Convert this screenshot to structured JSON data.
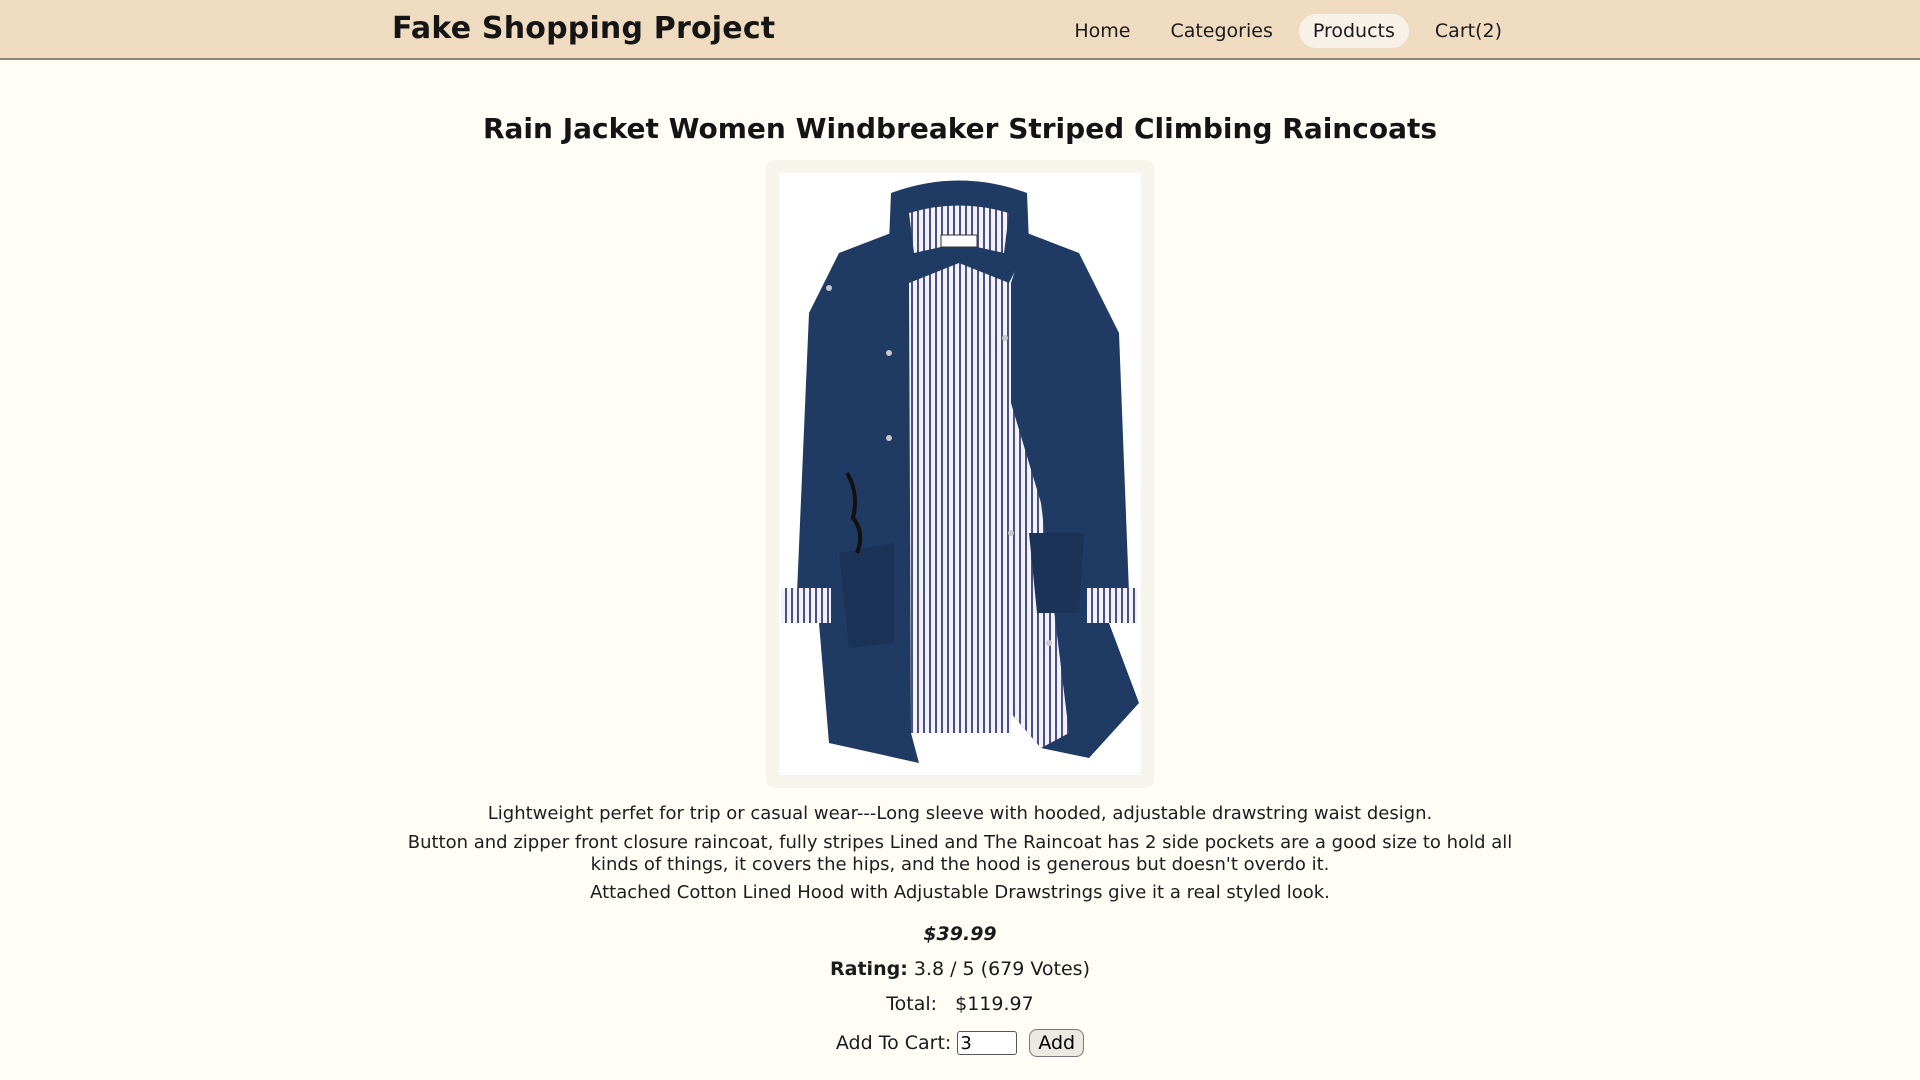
{
  "header": {
    "brand": "Fake Shopping Project",
    "nav": [
      {
        "label": "Home"
      },
      {
        "label": "Categories"
      },
      {
        "label": "Products",
        "active": true
      },
      {
        "label": "Cart(2)"
      }
    ]
  },
  "product": {
    "title": "Rain Jacket Women Windbreaker Striped Climbing Raincoats",
    "image_icon": "navy-rain-jacket-image",
    "description": [
      "Lightweight perfet for trip or casual wear---Long sleeve with hooded, adjustable drawstring waist design.",
      "Button and zipper front closure raincoat, fully stripes Lined and The Raincoat has 2 side pockets are a good size to hold all kinds of things, it covers the hips, and the hood is generous but doesn't overdo it.",
      "Attached Cotton Lined Hood with Adjustable Drawstrings give it a real styled look."
    ],
    "price": "$39.99",
    "rating_label": "Rating:",
    "rating_value": "3.8 / 5 (679 Votes)",
    "total_label": "Total:",
    "total_value": "$119.97",
    "add_to_cart_label": "Add To Cart:",
    "quantity": "3",
    "add_button": "Add"
  },
  "colors": {
    "header_bg": "#efdbbf",
    "page_bg": "#fffdf6",
    "jacket_navy": "#1e3a5f"
  }
}
